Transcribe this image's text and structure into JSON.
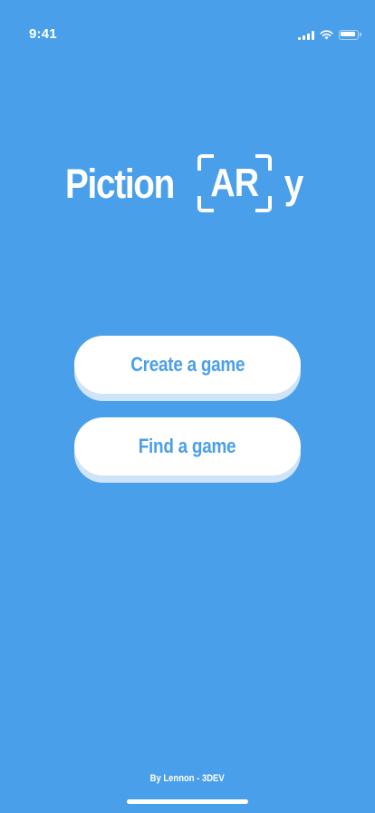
{
  "status_bar": {
    "time": "9:41",
    "icons": [
      "signal-icon",
      "wifi-icon",
      "battery-icon"
    ]
  },
  "logo": {
    "part1": "Piction",
    "part2": "AR",
    "part3": "y"
  },
  "menu": {
    "create_label": "Create a game",
    "find_label": "Find a game"
  },
  "footer": {
    "credit": "By Lennon - 3DEV"
  },
  "colors": {
    "background": "#4a9fea",
    "button_bg": "#ffffff",
    "button_text": "#4a9fea",
    "button_shadow": "#cfe4f8"
  }
}
